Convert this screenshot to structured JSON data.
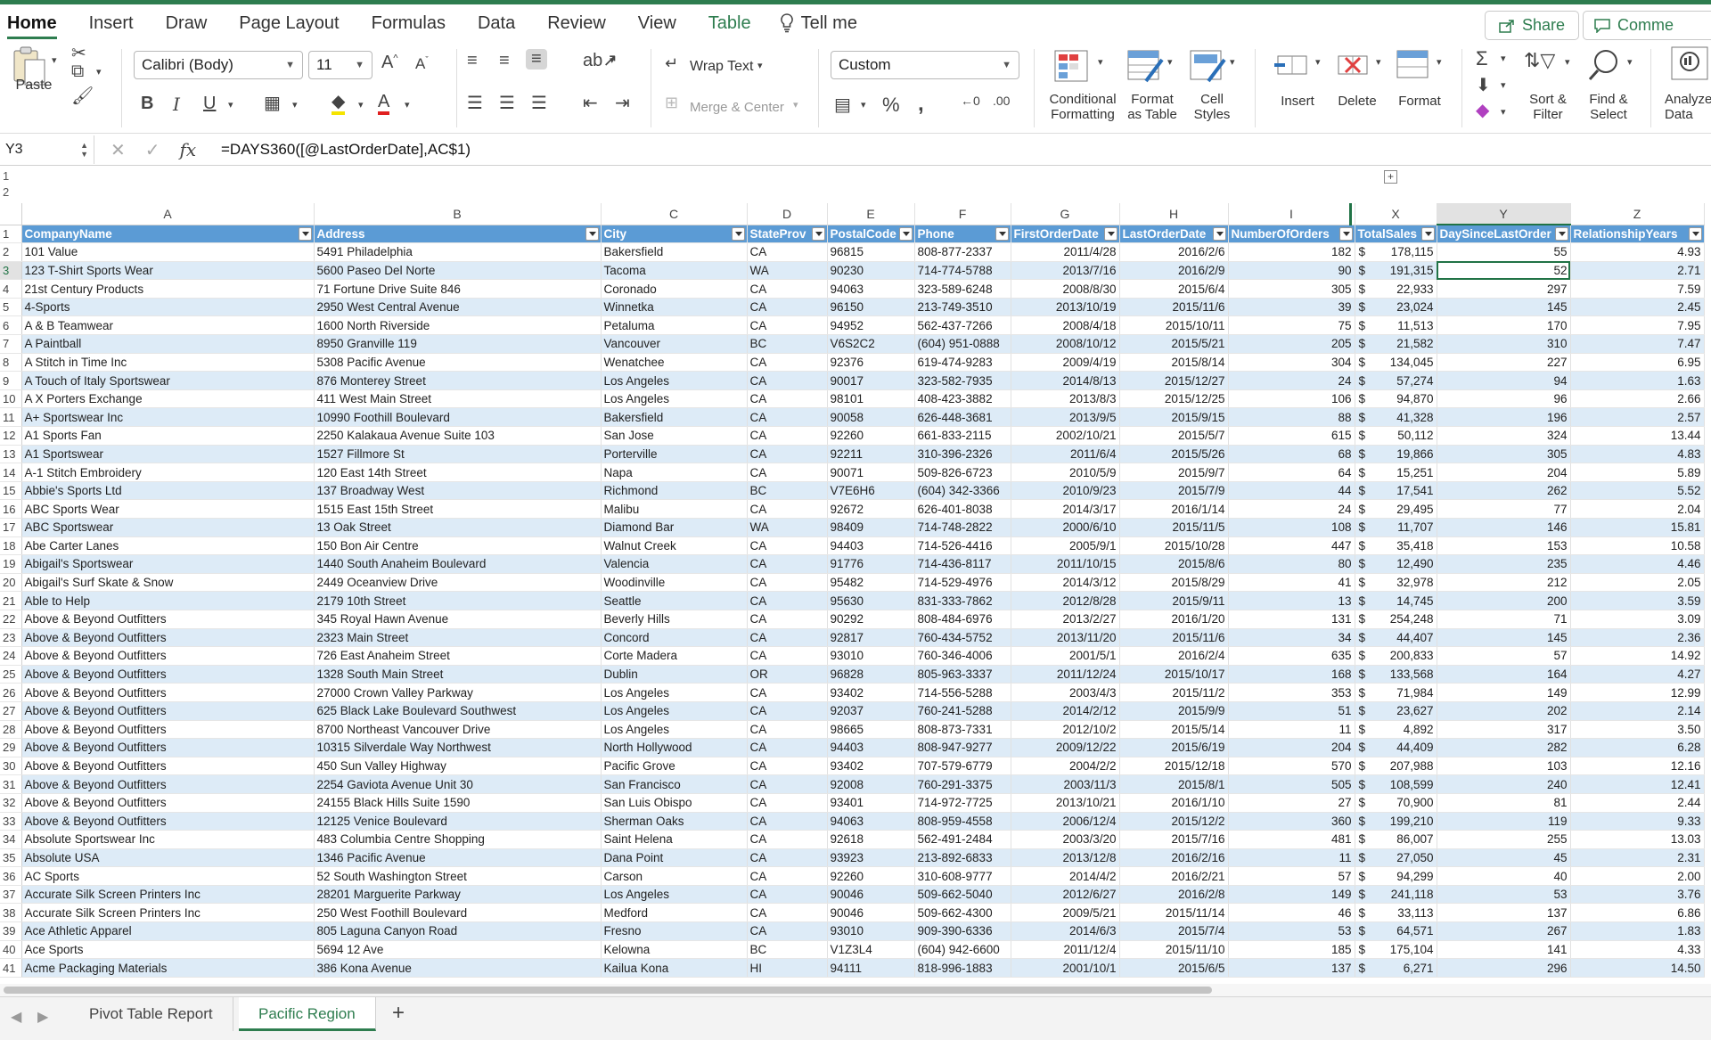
{
  "ribbon_tabs": [
    "Home",
    "Insert",
    "Draw",
    "Page Layout",
    "Formulas",
    "Data",
    "Review",
    "View",
    "Table"
  ],
  "tell_me": "Tell me",
  "share_label": "Share",
  "comments_label": "Comme",
  "clipboard": {
    "paste": "Paste"
  },
  "font": {
    "name": "Calibri (Body)",
    "size": "11"
  },
  "alignment": {
    "wrap_text": "Wrap Text",
    "merge_center": "Merge & Center"
  },
  "number": {
    "format": "Custom"
  },
  "styles": {
    "conditional": "Conditional\nFormatting",
    "format_table": "Format\nas Table",
    "cell_styles": "Cell\nStyles"
  },
  "cells": {
    "insert": "Insert",
    "delete": "Delete",
    "format": "Format"
  },
  "editing": {
    "sort_filter": "Sort &\nFilter",
    "find_select": "Find &\nSelect",
    "analyze": "Analyze\nData"
  },
  "formula_bar": {
    "cell_ref": "Y3",
    "formula": "=DAYS360([@LastOrderDate],AC$1)"
  },
  "outline_levels": [
    "1",
    "2"
  ],
  "columns": [
    "A",
    "B",
    "C",
    "D",
    "E",
    "F",
    "G",
    "H",
    "I",
    "X",
    "Y",
    "Z"
  ],
  "headers": [
    "CompanyName",
    "Address",
    "City",
    "StateProv",
    "PostalCode",
    "Phone",
    "FirstOrderDate",
    "LastOrderDate",
    "NumberOfOrders",
    "TotalSales",
    "DaySinceLastOrder",
    "RelationshipYears"
  ],
  "selected": {
    "column": "Y",
    "row": "3"
  },
  "rows": [
    [
      "2",
      "101 Value",
      "5491 Philadelphia",
      "Bakersfield",
      "CA",
      "96815",
      "808-877-2337",
      "2011/4/28",
      "2016/2/6",
      "182",
      "178,115",
      "55",
      "4.93"
    ],
    [
      "3",
      "123 T-Shirt Sports Wear",
      "5600 Paseo Del Norte",
      "Tacoma",
      "WA",
      "90230",
      "714-774-5788",
      "2013/7/16",
      "2016/2/9",
      "90",
      "191,315",
      "52",
      "2.71"
    ],
    [
      "4",
      "21st Century Products",
      "71 Fortune Drive Suite 846",
      "Coronado",
      "CA",
      "94063",
      "323-589-6248",
      "2008/8/30",
      "2015/6/4",
      "305",
      "22,933",
      "297",
      "7.59"
    ],
    [
      "5",
      "4-Sports",
      "2950 West Central Avenue",
      "Winnetka",
      "CA",
      "96150",
      "213-749-3510",
      "2013/10/19",
      "2015/11/6",
      "39",
      "23,024",
      "145",
      "2.45"
    ],
    [
      "6",
      "A & B Teamwear",
      "1600 North Riverside",
      "Petaluma",
      "CA",
      "94952",
      "562-437-7266",
      "2008/4/18",
      "2015/10/11",
      "75",
      "11,513",
      "170",
      "7.95"
    ],
    [
      "7",
      "A Paintball",
      "8950 Granville 119",
      "Vancouver",
      "BC",
      "V6S2C2",
      "(604) 951-0888",
      "2008/10/12",
      "2015/5/21",
      "205",
      "21,582",
      "310",
      "7.47"
    ],
    [
      "8",
      "A Stitch in Time Inc",
      "5308 Pacific Avenue",
      "Wenatchee",
      "CA",
      "92376",
      "619-474-9283",
      "2009/4/19",
      "2015/8/14",
      "304",
      "134,045",
      "227",
      "6.95"
    ],
    [
      "9",
      "A Touch of Italy Sportswear",
      "876 Monterey Street",
      "Los Angeles",
      "CA",
      "90017",
      "323-582-7935",
      "2014/8/13",
      "2015/12/27",
      "24",
      "57,274",
      "94",
      "1.63"
    ],
    [
      "10",
      "A X Porters Exchange",
      "411 West Main Street",
      "Los Angeles",
      "CA",
      "98101",
      "408-423-3882",
      "2013/8/3",
      "2015/12/25",
      "106",
      "94,870",
      "96",
      "2.66"
    ],
    [
      "11",
      "A+ Sportswear Inc",
      "10990 Foothill Boulevard",
      "Bakersfield",
      "CA",
      "90058",
      "626-448-3681",
      "2013/9/5",
      "2015/9/15",
      "88",
      "41,328",
      "196",
      "2.57"
    ],
    [
      "12",
      "A1 Sports Fan",
      "2250 Kalakaua Avenue Suite 103",
      "San Jose",
      "CA",
      "92260",
      "661-833-2115",
      "2002/10/21",
      "2015/5/7",
      "615",
      "50,112",
      "324",
      "13.44"
    ],
    [
      "13",
      "A1 Sportswear",
      "1527 Fillmore St",
      "Porterville",
      "CA",
      "92211",
      "310-396-2326",
      "2011/6/4",
      "2015/5/26",
      "68",
      "19,866",
      "305",
      "4.83"
    ],
    [
      "14",
      "A-1 Stitch Embroidery",
      "120 East 14th Street",
      "Napa",
      "CA",
      "90071",
      "509-826-6723",
      "2010/5/9",
      "2015/9/7",
      "64",
      "15,251",
      "204",
      "5.89"
    ],
    [
      "15",
      "Abbie's Sports Ltd",
      "137 Broadway West",
      "Richmond",
      "BC",
      "V7E6H6",
      "(604) 342-3366",
      "2010/9/23",
      "2015/7/9",
      "44",
      "17,541",
      "262",
      "5.52"
    ],
    [
      "16",
      "ABC Sports Wear",
      "1515 East 15th Street",
      "Malibu",
      "CA",
      "92672",
      "626-401-8038",
      "2014/3/17",
      "2016/1/14",
      "24",
      "29,495",
      "77",
      "2.04"
    ],
    [
      "17",
      "ABC Sportswear",
      "13 Oak Street",
      "Diamond Bar",
      "WA",
      "98409",
      "714-748-2822",
      "2000/6/10",
      "2015/11/5",
      "108",
      "11,707",
      "146",
      "15.81"
    ],
    [
      "18",
      "Abe Carter Lanes",
      "150 Bon Air Centre",
      "Walnut Creek",
      "CA",
      "94403",
      "714-526-4416",
      "2005/9/1",
      "2015/10/28",
      "447",
      "35,418",
      "153",
      "10.58"
    ],
    [
      "19",
      "Abigail's Sportswear",
      "1440 South Anaheim Boulevard",
      "Valencia",
      "CA",
      "91776",
      "714-436-8117",
      "2011/10/15",
      "2015/8/6",
      "80",
      "12,490",
      "235",
      "4.46"
    ],
    [
      "20",
      "Abigail's Surf Skate & Snow",
      "2449 Oceanview Drive",
      "Woodinville",
      "CA",
      "95482",
      "714-529-4976",
      "2014/3/12",
      "2015/8/29",
      "41",
      "32,978",
      "212",
      "2.05"
    ],
    [
      "21",
      "Able to Help",
      "2179 10th Street",
      "Seattle",
      "CA",
      "95630",
      "831-333-7862",
      "2012/8/28",
      "2015/9/11",
      "13",
      "14,745",
      "200",
      "3.59"
    ],
    [
      "22",
      "Above & Beyond Outfitters",
      "345 Royal Hawn Avenue",
      "Beverly Hills",
      "CA",
      "90292",
      "808-484-6976",
      "2013/2/27",
      "2016/1/20",
      "131",
      "254,248",
      "71",
      "3.09"
    ],
    [
      "23",
      "Above & Beyond Outfitters",
      "2323 Main Street",
      "Concord",
      "CA",
      "92817",
      "760-434-5752",
      "2013/11/20",
      "2015/11/6",
      "34",
      "44,407",
      "145",
      "2.36"
    ],
    [
      "24",
      "Above & Beyond Outfitters",
      "726 East Anaheim Street",
      "Corte Madera",
      "CA",
      "93010",
      "760-346-4006",
      "2001/5/1",
      "2016/2/4",
      "635",
      "200,833",
      "57",
      "14.92"
    ],
    [
      "25",
      "Above & Beyond Outfitters",
      "1328 South Main Street",
      "Dublin",
      "OR",
      "96828",
      "805-963-3337",
      "2011/12/24",
      "2015/10/17",
      "168",
      "133,568",
      "164",
      "4.27"
    ],
    [
      "26",
      "Above & Beyond Outfitters",
      "27000 Crown Valley Parkway",
      "Los Angeles",
      "CA",
      "93402",
      "714-556-5288",
      "2003/4/3",
      "2015/11/2",
      "353",
      "71,984",
      "149",
      "12.99"
    ],
    [
      "27",
      "Above & Beyond Outfitters",
      "625 Black Lake Boulevard Southwest",
      "Los Angeles",
      "CA",
      "92037",
      "760-241-5288",
      "2014/2/12",
      "2015/9/9",
      "51",
      "23,627",
      "202",
      "2.14"
    ],
    [
      "28",
      "Above & Beyond Outfitters",
      "8700 Northeast Vancouver Drive",
      "Los Angeles",
      "CA",
      "98665",
      "808-873-7331",
      "2012/10/2",
      "2015/5/14",
      "11",
      "4,892",
      "317",
      "3.50"
    ],
    [
      "29",
      "Above & Beyond Outfitters",
      "10315 Silverdale Way Northwest",
      "North Hollywood",
      "CA",
      "94403",
      "808-947-9277",
      "2009/12/22",
      "2015/6/19",
      "204",
      "44,409",
      "282",
      "6.28"
    ],
    [
      "30",
      "Above & Beyond Outfitters",
      "450 Sun Valley Highway",
      "Pacific Grove",
      "CA",
      "93402",
      "707-579-6779",
      "2004/2/2",
      "2015/12/18",
      "570",
      "207,988",
      "103",
      "12.16"
    ],
    [
      "31",
      "Above & Beyond Outfitters",
      "2254 Gaviota Avenue Unit 30",
      "San Francisco",
      "CA",
      "92008",
      "760-291-3375",
      "2003/11/3",
      "2015/8/1",
      "505",
      "108,599",
      "240",
      "12.41"
    ],
    [
      "32",
      "Above & Beyond Outfitters",
      "24155 Black Hills Suite 1590",
      "San Luis Obispo",
      "CA",
      "93401",
      "714-972-7725",
      "2013/10/21",
      "2016/1/10",
      "27",
      "70,900",
      "81",
      "2.44"
    ],
    [
      "33",
      "Above & Beyond Outfitters",
      "12125 Venice Boulevard",
      "Sherman Oaks",
      "CA",
      "94063",
      "808-959-4558",
      "2006/12/4",
      "2015/12/2",
      "360",
      "199,210",
      "119",
      "9.33"
    ],
    [
      "34",
      "Absolute Sportswear Inc",
      "483 Columbia Centre Shopping",
      "Saint Helena",
      "CA",
      "92618",
      "562-491-2484",
      "2003/3/20",
      "2015/7/16",
      "481",
      "86,007",
      "255",
      "13.03"
    ],
    [
      "35",
      "Absolute USA",
      "1346 Pacific Avenue",
      "Dana Point",
      "CA",
      "93923",
      "213-892-6833",
      "2013/12/8",
      "2016/2/16",
      "11",
      "27,050",
      "45",
      "2.31"
    ],
    [
      "36",
      "AC Sports",
      "52 South Washington Street",
      "Carson",
      "CA",
      "92260",
      "310-608-9777",
      "2014/4/2",
      "2016/2/21",
      "57",
      "94,299",
      "40",
      "2.00"
    ],
    [
      "37",
      "Accurate Silk Screen Printers Inc",
      "28201 Marguerite Parkway",
      "Los Angeles",
      "CA",
      "90046",
      "509-662-5040",
      "2012/6/27",
      "2016/2/8",
      "149",
      "241,118",
      "53",
      "3.76"
    ],
    [
      "38",
      "Accurate Silk Screen Printers Inc",
      "250 West Foothill Boulevard",
      "Medford",
      "CA",
      "90046",
      "509-662-4300",
      "2009/5/21",
      "2015/11/14",
      "46",
      "33,113",
      "137",
      "6.86"
    ],
    [
      "39",
      "Ace Athletic Apparel",
      "805 Laguna Canyon Road",
      "Fresno",
      "CA",
      "93010",
      "909-390-6336",
      "2014/6/3",
      "2015/7/4",
      "53",
      "64,571",
      "267",
      "1.83"
    ],
    [
      "40",
      "Ace Sports",
      "5694 12 Ave",
      "Kelowna",
      "BC",
      "V1Z3L4",
      "(604) 942-6600",
      "2011/12/4",
      "2015/11/10",
      "185",
      "175,104",
      "141",
      "4.33"
    ],
    [
      "41",
      "Acme Packaging Materials",
      "386 Kona Avenue",
      "Kailua Kona",
      "HI",
      "94111",
      "818-996-1883",
      "2001/10/1",
      "2015/6/5",
      "137",
      "6,271",
      "296",
      "14.50"
    ]
  ],
  "currency_symbol": "$",
  "sheet_tabs": [
    "Pivot Table Report",
    "Pacific Region"
  ],
  "active_sheet": "Pacific Region",
  "colors": {
    "accent": "#2e7d4f",
    "table_header": "#5b9bd5",
    "band": "#ddebf7",
    "selection": "#217346"
  }
}
